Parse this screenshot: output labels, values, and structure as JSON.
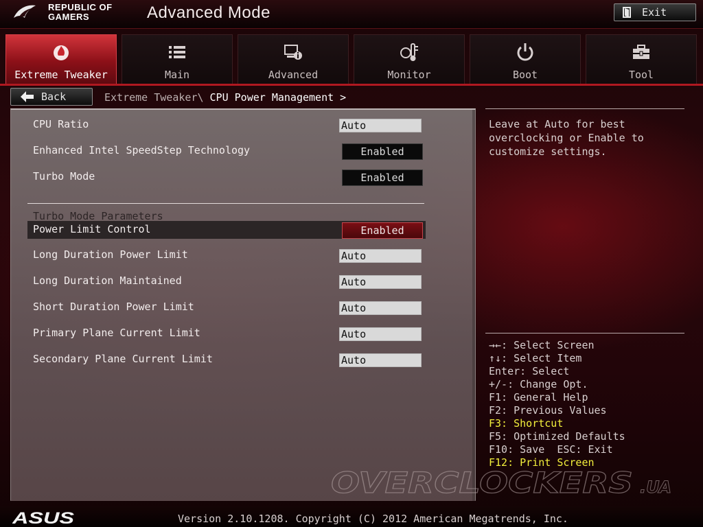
{
  "header": {
    "brand_line1": "REPUBLIC OF",
    "brand_line2": "GAMERS",
    "mode_title": "Advanced Mode",
    "exit_label": "Exit"
  },
  "tabs": [
    {
      "label": "Extreme Tweaker",
      "icon": "flame-icon",
      "active": true
    },
    {
      "label": "Main",
      "icon": "list-icon",
      "active": false
    },
    {
      "label": "Advanced",
      "icon": "advanced-info-icon",
      "active": false
    },
    {
      "label": "Monitor",
      "icon": "thermometer-icon",
      "active": false
    },
    {
      "label": "Boot",
      "icon": "power-icon",
      "active": false
    },
    {
      "label": "Tool",
      "icon": "toolbox-icon",
      "active": false
    }
  ],
  "nav": {
    "back_label": "Back",
    "breadcrumb_parent": "Extreme Tweaker\\",
    "breadcrumb_current": "CPU Power Management >"
  },
  "settings": [
    {
      "label": "CPU Ratio",
      "value": "Auto"
    },
    {
      "label": "Enhanced Intel SpeedStep Technology",
      "value": "Enabled"
    },
    {
      "label": "Turbo Mode",
      "value": "Enabled"
    }
  ],
  "section": {
    "title": "Turbo Mode Parameters"
  },
  "turbo_settings": [
    {
      "label": "Power Limit Control",
      "value": "Enabled",
      "selected": true
    },
    {
      "label": "Long Duration Power Limit",
      "value": "Auto"
    },
    {
      "label": "Long Duration Maintained",
      "value": "Auto"
    },
    {
      "label": "Short Duration Power Limit",
      "value": "Auto"
    },
    {
      "label": "Primary Plane Current Limit",
      "value": "Auto"
    },
    {
      "label": "Secondary Plane Current Limit",
      "value": "Auto"
    }
  ],
  "help": {
    "text": "Leave at Auto for best overclocking or Enable to customize settings."
  },
  "keys": [
    {
      "text": "→←: Select Screen",
      "highlight": false
    },
    {
      "text": "↑↓: Select Item",
      "highlight": false
    },
    {
      "text": "Enter: Select",
      "highlight": false
    },
    {
      "text": "+/-: Change Opt.",
      "highlight": false
    },
    {
      "text": "F1: General Help",
      "highlight": false
    },
    {
      "text": "F2: Previous Values",
      "highlight": false
    },
    {
      "text": "F3: Shortcut",
      "highlight": true
    },
    {
      "text": "F5: Optimized Defaults",
      "highlight": false
    },
    {
      "text": "F10: Save  ESC: Exit",
      "highlight": false
    },
    {
      "text": "F12: Print Screen",
      "highlight": true
    }
  ],
  "watermark": {
    "text": "OVERCLOCKERS",
    "suffix": ".UA"
  },
  "footer": {
    "brand": "ASUS",
    "version": "Version 2.10.1208. Copyright (C) 2012 American Megatrends, Inc."
  },
  "colors": {
    "accent_red": "#b01820",
    "highlight_yellow": "#f3f03c",
    "panel_gray": "#807878"
  }
}
